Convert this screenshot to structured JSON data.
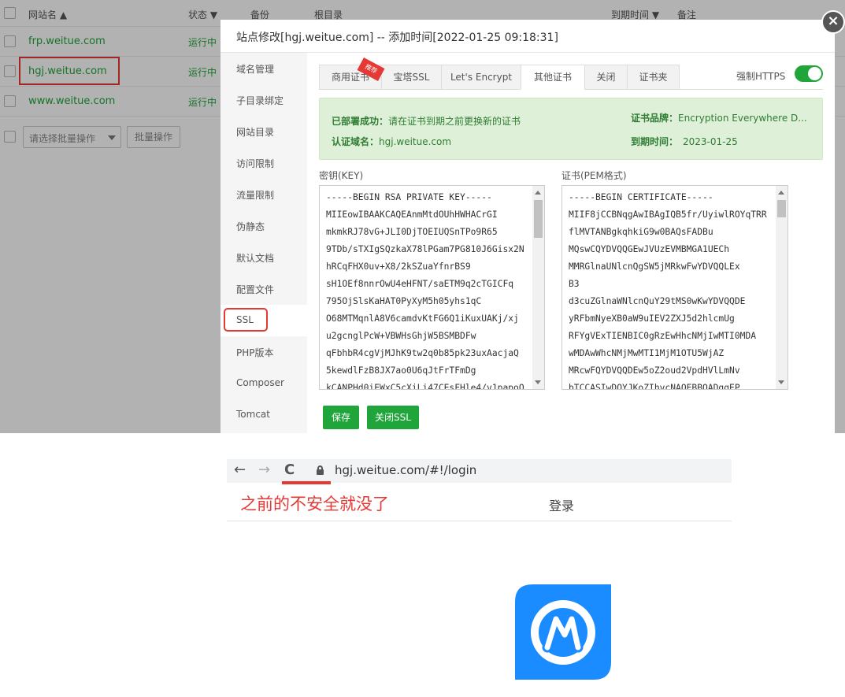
{
  "site_list": {
    "headers": {
      "name": "网站名 ▲",
      "status": "状态 ▼",
      "backup": "备份",
      "root": "根目录",
      "expire": "到期时间 ▼",
      "remark": "备注"
    },
    "rows": [
      {
        "domain": "frp.weitue.com",
        "status": "运行中"
      },
      {
        "domain": "hgj.weitue.com",
        "status": "运行中"
      },
      {
        "domain": "www.weitue.com",
        "status": "运行中"
      }
    ],
    "batch_placeholder": "请选择批量操作",
    "batch_button": "批量操作"
  },
  "dialog": {
    "title": "站点修改[hgj.weitue.com] -- 添加时间[2022-01-25 09:18:31]",
    "close_label": "×",
    "nav": [
      "域名管理",
      "子目录绑定",
      "网站目录",
      "访问限制",
      "流量限制",
      "伪静态",
      "默认文档",
      "配置文件",
      "SSL",
      "PHP版本",
      "Composer",
      "Tomcat"
    ],
    "active_nav": "SSL",
    "tabs": [
      "商用证书",
      "宝塔SSL",
      "Let's Encrypt",
      "其他证书",
      "关闭",
      "证书夹"
    ],
    "active_tab": "其他证书",
    "ribbon": "推荐",
    "force_https_label": "强制HTTPS",
    "force_https_on": true,
    "info": {
      "deploy_key": "已部署成功：",
      "deploy_value": "请在证书到期之前更换新的证书",
      "domain_key": "认证域名：",
      "domain_value": "hgj.weitue.com",
      "brand_key": "证书品牌：",
      "brand_value": "Encryption Everywhere D...",
      "expire_key": "到期时间：",
      "expire_value": "2023-01-25"
    },
    "key_label": "密钥(KEY)",
    "cert_label": "证书(PEM格式)",
    "key_lines": [
      "-----BEGIN RSA PRIVATE KEY-----",
      "MIIEowIBAAKCAQEAnmMtdOUhHWHACrGI",
      "mkmkRJ78vG+JLI0DjTOEIUQSnTPo9R65",
      "9TDb/sTXIgSQzkaX78lPGam7PG810J6Gisx2N",
      "hRCqFHX0uv+X8/2kSZuaYfnrBS9",
      "sH1OEf8nnrOwU4eHFNT/saETM9q2cTGICFq",
      "795OjSlsKaHAT0PyXyM5h05yhs1qC",
      "O68MTMqnlA8V6camdvKtFG6Q1iKuxUAKj/xj",
      "u2gcnglPcW+VBWHsGhjW5BSMBDFw",
      "qFbhbR4cgVjMJhK9tw2q0b85pk23uxAacjaQ",
      "5kewdlFzB8JX7ao0U6qJtFrTFmDg",
      "kCANPHd0iEWxC5cXiLi47CEsFHle4/v1papoO"
    ],
    "cert_lines": [
      "-----BEGIN CERTIFICATE-----",
      "MIIF8jCCBNqgAwIBAgIQB5fr/UyiwlROYqTRR",
      "flMVTANBgkqhkiG9w0BAQsFADBu",
      "MQswCQYDVQQGEwJVUzEVMBMGA1UECh",
      "MMRGlnaUNlcnQgSW5jMRkwFwYDVQQLEx",
      "B3",
      "d3cuZGlnaWNlcnQuY29tMS0wKwYDVQQDE",
      "yRFbmNyeXB0aW9uIEV2ZXJ5d2hlcmUg",
      "RFYgVExTIENBIC0gRzEwHhcNMjIwMTI0MDA",
      "wMDAwWhcNMjMwMTI1MjM1OTU5WjAZ",
      "MRcwFQYDVQQDEw5oZ2oud2VpdHVlLmNv",
      "bTCCASIwDQYJKoZIhvcNAQEBBQADggEP"
    ],
    "save_button": "保存",
    "close_ssl_button": "关闭SSL"
  },
  "browser": {
    "back": "←",
    "forward": "→",
    "reload": "C",
    "url": "hgj.weitue.com/#!/login",
    "note": "之前的不安全就没了",
    "login_title": "登录"
  },
  "colors": {
    "accent_green": "#20a53a",
    "annotation_red": "#e53935",
    "logo_blue": "#1a8cff"
  }
}
